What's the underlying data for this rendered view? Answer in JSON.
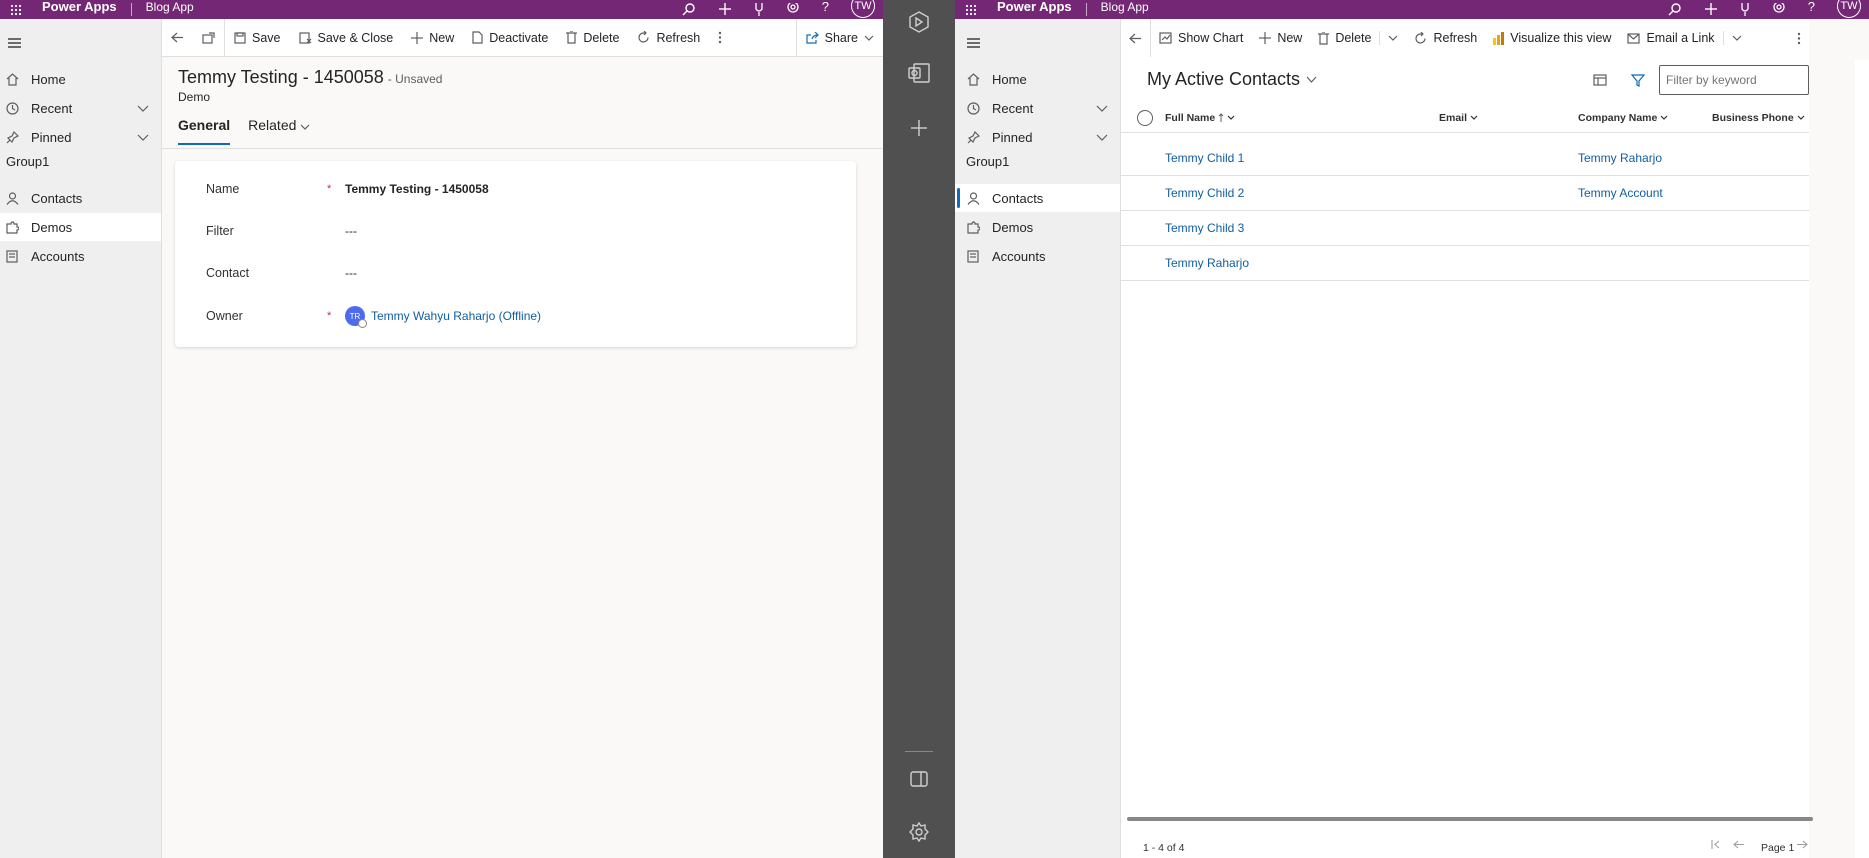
{
  "left": {
    "topbar": {
      "app_name": "Power Apps",
      "sub_name": "Blog App",
      "avatar": "TW"
    },
    "nav": {
      "items": [
        {
          "label": "Home",
          "icon": "home-icon"
        },
        {
          "label": "Recent",
          "icon": "clock-icon"
        },
        {
          "label": "Pinned",
          "icon": "pin-icon"
        }
      ],
      "group": "Group1",
      "entities": [
        {
          "label": "Contacts",
          "icon": "person-icon"
        },
        {
          "label": "Demos",
          "icon": "puzzle-icon"
        },
        {
          "label": "Accounts",
          "icon": "document-icon"
        }
      ]
    },
    "commands": {
      "save": "Save",
      "save_close": "Save & Close",
      "new": "New",
      "deactivate": "Deactivate",
      "delete": "Delete",
      "refresh": "Refresh",
      "share": "Share"
    },
    "record": {
      "title": "Temmy Testing - 1450058",
      "status": "- Unsaved",
      "entity": "Demo"
    },
    "tabs": [
      "General",
      "Related"
    ],
    "fields": {
      "name_label": "Name",
      "name_value": "Temmy Testing - 1450058",
      "filter_label": "Filter",
      "filter_value": "---",
      "contact_label": "Contact",
      "contact_value": "---",
      "owner_label": "Owner",
      "owner_initials": "TR",
      "owner_value": "Temmy Wahyu Raharjo (Offline)",
      "required_mark": "*"
    }
  },
  "right": {
    "topbar": {
      "app_name": "Power Apps",
      "sub_name": "Blog App",
      "avatar": "TW"
    },
    "nav": {
      "items": [
        {
          "label": "Home"
        },
        {
          "label": "Recent"
        },
        {
          "label": "Pinned"
        }
      ],
      "group": "Group1",
      "entities": [
        {
          "label": "Contacts"
        },
        {
          "label": "Demos"
        },
        {
          "label": "Accounts"
        }
      ]
    },
    "commands": {
      "show_chart": "Show Chart",
      "new": "New",
      "delete": "Delete",
      "refresh": "Refresh",
      "visualize": "Visualize this view",
      "email_link": "Email a Link"
    },
    "view": {
      "title": "My Active Contacts",
      "filter_placeholder": "Filter by keyword",
      "columns": [
        "Full Name",
        "Email",
        "Company Name",
        "Business Phone"
      ],
      "rows": [
        {
          "full_name": "Temmy Child 1",
          "email": "",
          "company": "Temmy Raharjo",
          "phone": ""
        },
        {
          "full_name": "Temmy Child 2",
          "email": "",
          "company": "Temmy Account",
          "phone": ""
        },
        {
          "full_name": "Temmy Child 3",
          "email": "",
          "company": "",
          "phone": ""
        },
        {
          "full_name": "Temmy Raharjo",
          "email": "",
          "company": "",
          "phone": ""
        }
      ],
      "record_count": "1 - 4 of 4",
      "page": "Page 1"
    }
  },
  "colors": {
    "brand": "#742774",
    "link": "#115ea3",
    "accent": "#0f6cbd",
    "rail": "#505050"
  }
}
